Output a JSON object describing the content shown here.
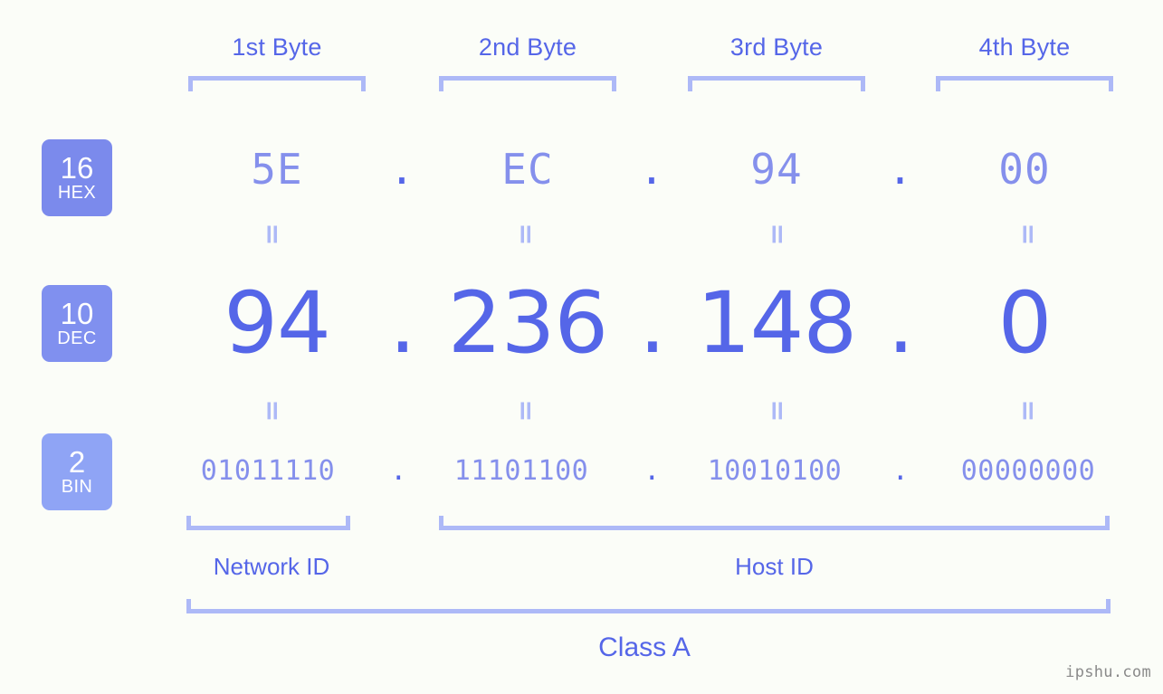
{
  "page": {
    "background_color": "#fbfdf8",
    "accent_strong": "#5566e8",
    "accent_medium": "#8590ec",
    "accent_light": "#adb9f7"
  },
  "byte_headers": [
    {
      "label": "1st Byte"
    },
    {
      "label": "2nd Byte"
    },
    {
      "label": "3rd Byte"
    },
    {
      "label": "4th Byte"
    }
  ],
  "radix_badges": [
    {
      "number": "16",
      "unit": "HEX",
      "color": "#7b8aec"
    },
    {
      "number": "10",
      "unit": "DEC",
      "color": "#8090ef"
    },
    {
      "number": "2",
      "unit": "BIN",
      "color": "#8fa4f5"
    }
  ],
  "rows": {
    "hex": {
      "values": [
        "5E",
        "EC",
        "94",
        "00"
      ],
      "separator": "."
    },
    "dec": {
      "values": [
        "94",
        "236",
        "148",
        "0"
      ],
      "separator": "."
    },
    "bin": {
      "values": [
        "01011110",
        "11101100",
        "10010100",
        "00000000"
      ],
      "separator": "."
    }
  },
  "equals_marks": {
    "symbol": "="
  },
  "segments": {
    "network_id": "Network ID",
    "host_id": "Host ID"
  },
  "class": {
    "label": "Class A"
  },
  "watermark": {
    "text": "ipshu.com"
  }
}
